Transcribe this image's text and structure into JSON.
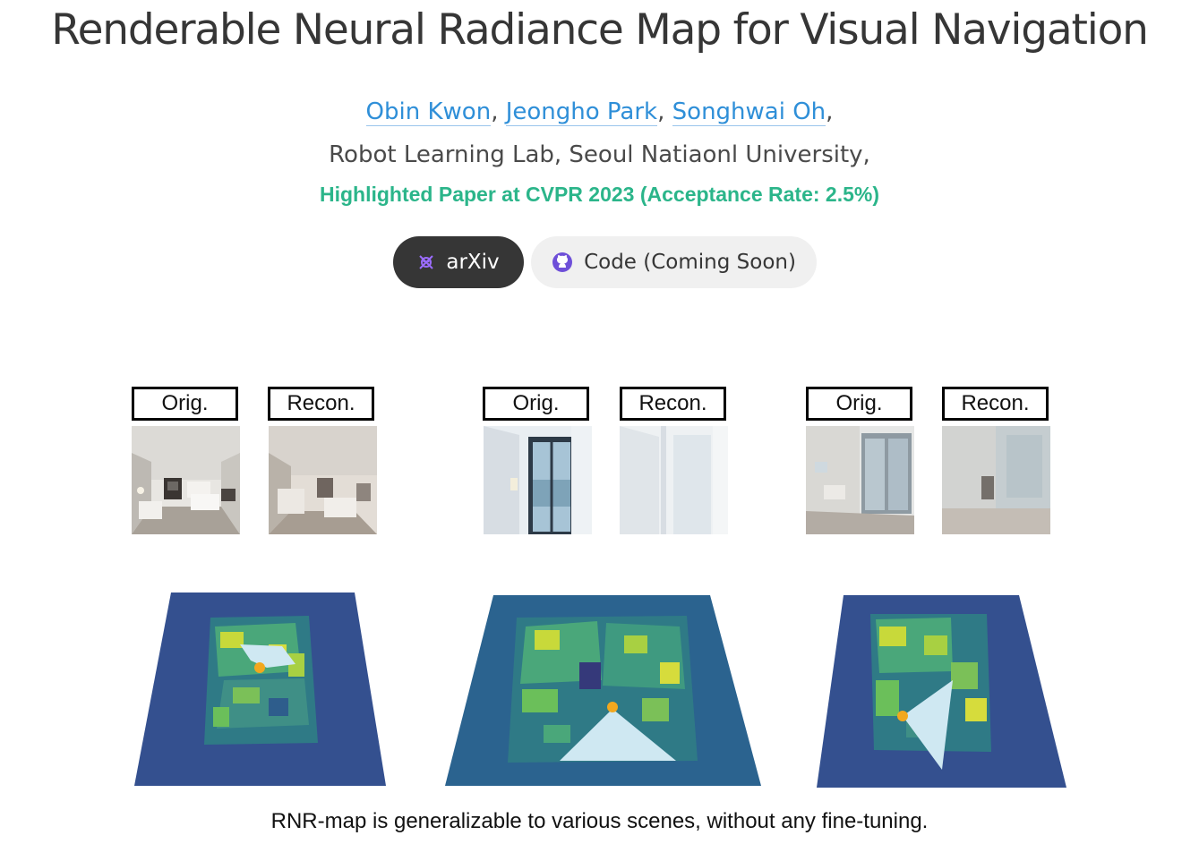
{
  "title": "Renderable Neural Radiance Map for Visual Navigation",
  "authors": [
    {
      "name": "Obin Kwon"
    },
    {
      "name": "Jeongho Park"
    },
    {
      "name": "Songhwai Oh"
    }
  ],
  "separators": {
    "comma": ","
  },
  "affiliation": "Robot Learning Lab, Seoul Natiaonl University,",
  "highlight": "Highlighted Paper at CVPR 2023 (Acceptance Rate: 2.5%)",
  "buttons": {
    "arxiv": {
      "label": "arXiv",
      "icon": "arxiv-icon"
    },
    "code": {
      "label": "Code (Coming Soon)",
      "icon": "github-icon"
    }
  },
  "figure": {
    "orig_label": "Orig.",
    "recon_label": "Recon.",
    "caption": "RNR-map is generalizable to various scenes, without any fine-tuning."
  },
  "colors": {
    "highlight": "#2bb58a",
    "link": "#2f8fd8",
    "map_background": "#34508f",
    "map_free_space": "#cfe8f2",
    "agent": "#f2a81e"
  }
}
